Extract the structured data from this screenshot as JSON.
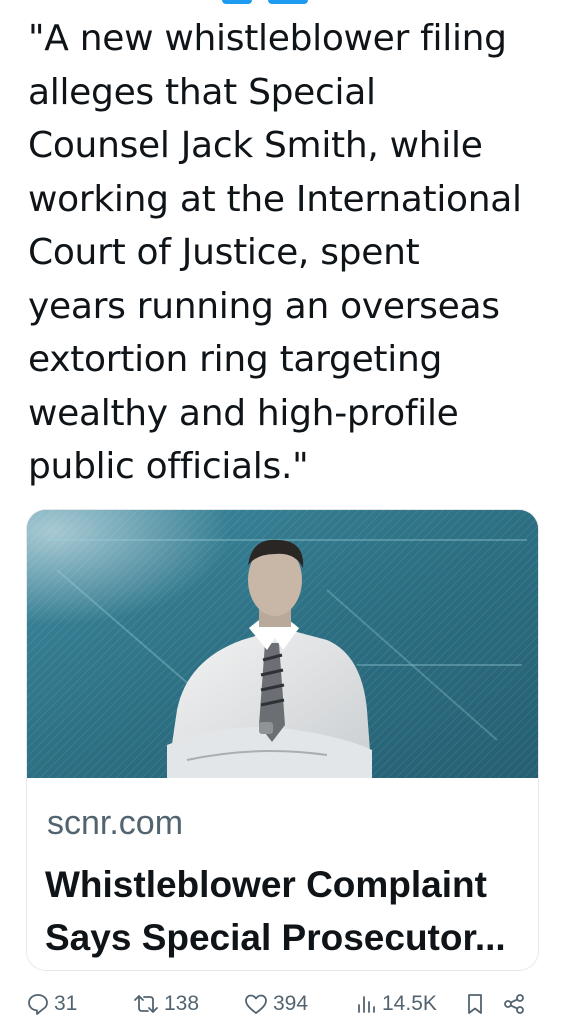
{
  "tweet": {
    "text_lines": [
      "\"A new whistleblower filing",
      "alleges that Special",
      "Counsel Jack Smith, while",
      "working at the International",
      "Court of Justice, spent",
      "years running an overseas",
      "extortion ring targeting",
      "wealthy and high-profile",
      "public officials.\""
    ]
  },
  "link_card": {
    "domain": "scnr.com",
    "headline_lines": [
      "Whistleblower Complaint",
      "Says Special Prosecutor..."
    ],
    "image_icon": "man-portrait-photo"
  },
  "actions": {
    "reply_count": "31",
    "repost_count": "138",
    "like_count": "394",
    "views_count": "14.5K",
    "icons": [
      "reply-icon",
      "repost-icon",
      "like-icon",
      "views-icon",
      "bookmark-icon",
      "share-icon"
    ]
  },
  "colors": {
    "text": "#0f1419",
    "secondary": "#536471",
    "card_image_bg": "#2f7488",
    "border": "#e6e9ec"
  }
}
